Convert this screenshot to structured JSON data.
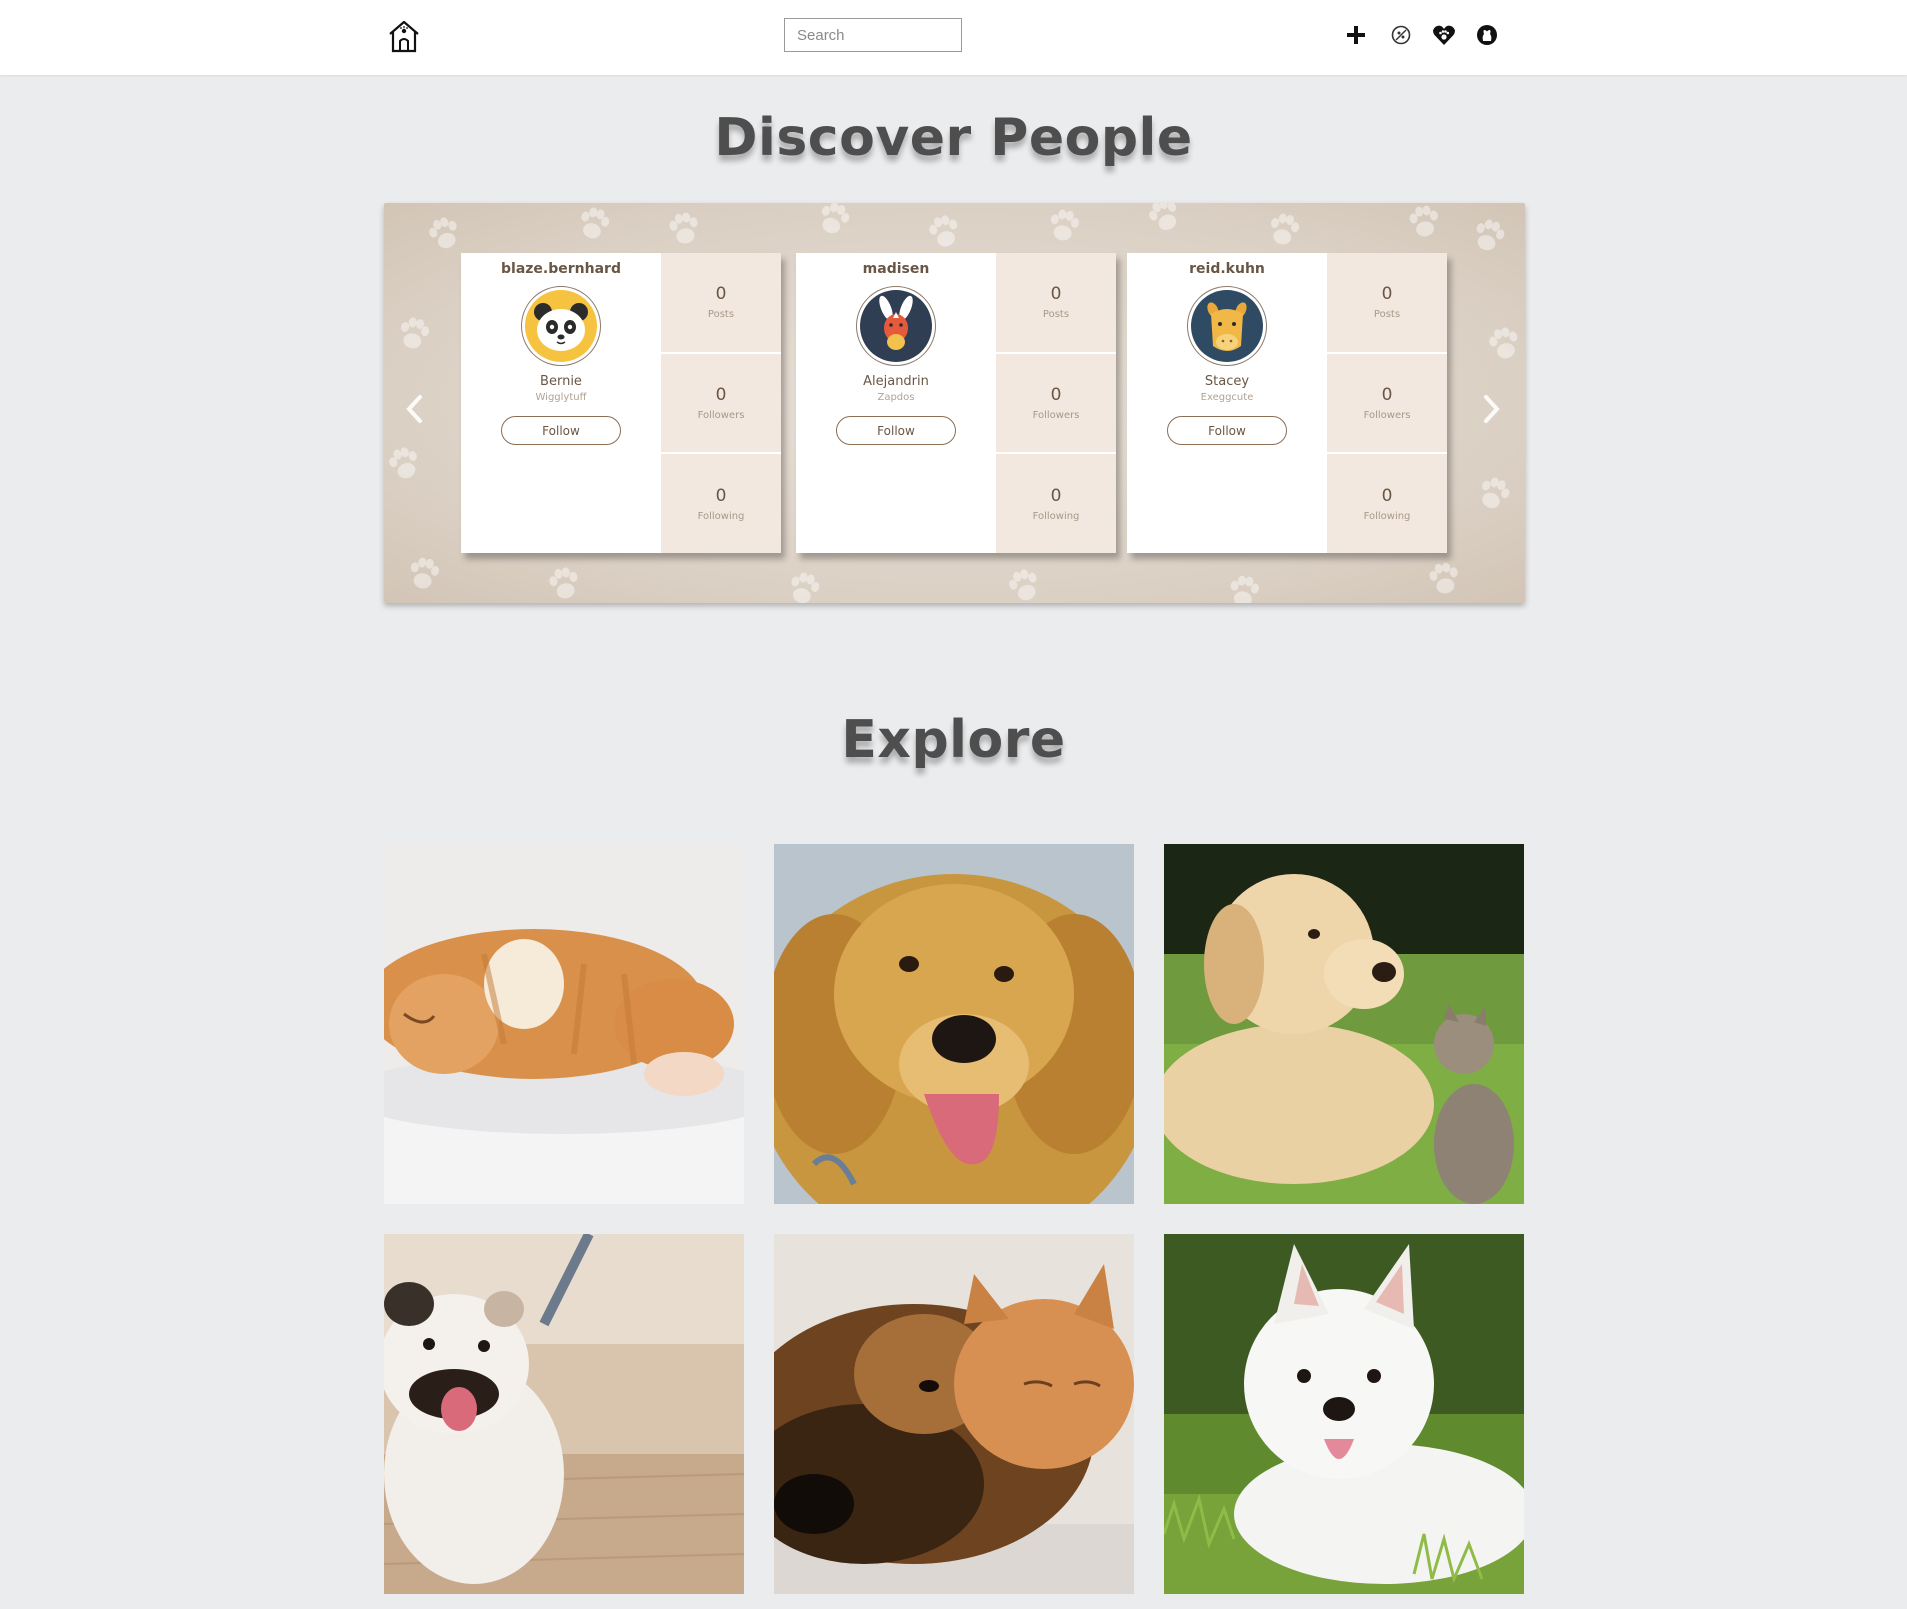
{
  "header": {
    "search_placeholder": "Search",
    "icons": [
      "home-icon",
      "plus-icon",
      "pet-icon",
      "paw-heart-icon",
      "github-icon"
    ]
  },
  "discover": {
    "title": "Discover People",
    "cards": [
      {
        "username": "blaze.bernhard",
        "pet_name": "Bernie",
        "pet_type": "Wigglytuff",
        "follow_label": "Follow",
        "posts": "0",
        "posts_label": "Posts",
        "followers": "0",
        "followers_label": "Followers",
        "following": "0",
        "following_label": "Following",
        "avatar": "panda-avatar"
      },
      {
        "username": "madisen",
        "pet_name": "Alejandrin",
        "pet_type": "Zapdos",
        "follow_label": "Follow",
        "posts": "0",
        "posts_label": "Posts",
        "followers": "0",
        "followers_label": "Followers",
        "following": "0",
        "following_label": "Following",
        "avatar": "donkey-avatar"
      },
      {
        "username": "reid.kuhn",
        "pet_name": "Stacey",
        "pet_type": "Exeggcute",
        "follow_label": "Follow",
        "posts": "0",
        "posts_label": "Posts",
        "followers": "0",
        "followers_label": "Followers",
        "following": "0",
        "following_label": "Following",
        "avatar": "camel-avatar"
      }
    ]
  },
  "explore": {
    "title": "Explore",
    "images": [
      "sleeping-orange-cat",
      "golden-retriever-puppy",
      "labrador-puppy-with-kitten",
      "bulldog-on-leash",
      "german-shepherd-with-cat",
      "west-highland-terrier"
    ]
  },
  "colors": {
    "background": "#ebecee",
    "accent": "#6a5645",
    "stat_bg": "#f2e8df"
  }
}
